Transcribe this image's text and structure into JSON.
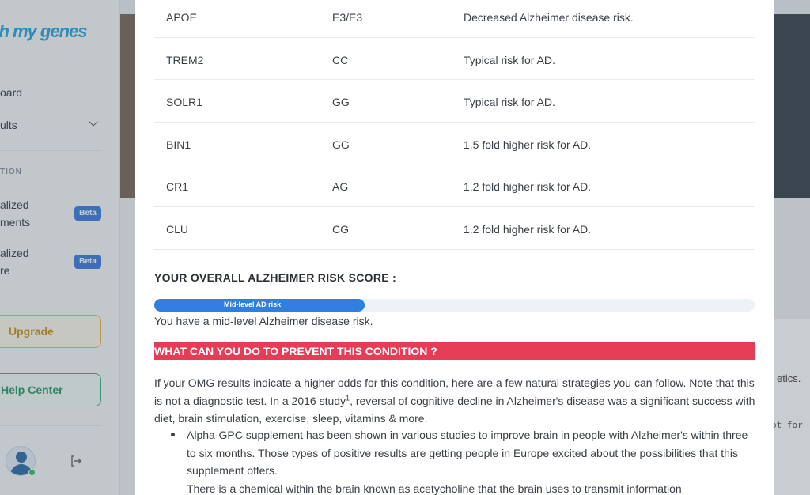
{
  "sidebar": {
    "logo_text": "oh my genes",
    "items": [
      {
        "label": "oard"
      },
      {
        "label": "ults"
      }
    ],
    "section_label": "TION",
    "beta_items": [
      {
        "line1": "alized",
        "line2": "ments",
        "badge": "Beta"
      },
      {
        "line1": "alized",
        "line2": "re",
        "badge": "Beta"
      }
    ],
    "upgrade_label": "Upgrade",
    "help_label": "Help Center"
  },
  "background": {
    "snippet_1": "etics.",
    "snippet_2": "ot for"
  },
  "genes": {
    "rows": [
      {
        "gene": "APOE",
        "genotype": "E3/E3",
        "result": "Decreased Alzheimer disease risk."
      },
      {
        "gene": "TREM2",
        "genotype": "CC",
        "result": "Typical risk for AD."
      },
      {
        "gene": "SOLR1",
        "genotype": "GG",
        "result": "Typical risk for AD."
      },
      {
        "gene": "BIN1",
        "genotype": "GG",
        "result": "1.5 fold higher risk for AD."
      },
      {
        "gene": "CR1",
        "genotype": "AG",
        "result": "1.2 fold higher risk for AD."
      },
      {
        "gene": "CLU",
        "genotype": "CG",
        "result": "1.2 fold higher risk for AD."
      }
    ]
  },
  "score": {
    "title": "YOUR OVERALL ALZHEIMER RISK SCORE :",
    "bar_label": "Mid-level AD risk",
    "bar_fraction": 0.35,
    "summary": "You have a mid-level Alzheimer disease risk.",
    "bar_color": "#2f7fe1"
  },
  "prevention": {
    "heading": "WHAT CAN YOU DO TO PREVENT THIS CONDITION ?",
    "heading_color": "#e63d56",
    "intro_before_sup": "If your OMG results indicate a higher odds for this condition, here are a few natural strategies you can follow. Note that this is not a diagnostic test. In a 2016 study",
    "intro_sup": "1",
    "intro_after_sup": ", reversal of cognitive decline in Alzheimer's disease was a significant success with diet, brain stimulation, exercise, sleep, vitamins & more.",
    "bullet_1": "Alpha-GPC supplement has been shown in various studies to improve brain in people with Alzheimer's within three to six months. Those types of positive results are getting people in Europe excited about the possibilities that this supplement offers.",
    "bullet_1_cont": "There is a chemical within the brain known as acetycholine that the brain uses to transmit information"
  }
}
